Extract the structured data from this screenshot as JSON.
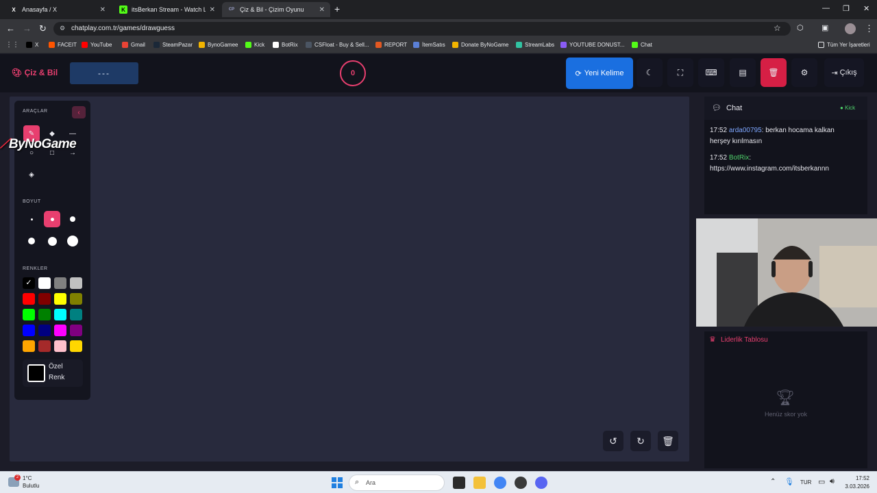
{
  "browser": {
    "tabs": [
      {
        "title": "Anasayfa / X",
        "favicon": "X"
      },
      {
        "title": "itsBerkan Stream - Watch Live o",
        "favicon": "K"
      },
      {
        "title": "Çiz & Bil - Çizim Oyunu",
        "favicon": "CP"
      }
    ],
    "url": "chatplay.com.tr/games/drawguess",
    "bookmarks": [
      "X",
      "FACEIT",
      "YouTube",
      "Gmail",
      "SteamPazar",
      "BynoGamee",
      "Kick",
      "BotRix",
      "CSFloat - Buy & Sell...",
      "REPORT",
      "İtemSatıs",
      "Donate ByNoGame",
      "StreamLabs",
      "YOUTUBE DONUST...",
      "Chat"
    ],
    "all_bookmarks": "Tüm Yer İşaretleri"
  },
  "app": {
    "logo": "Çiz & Bil",
    "word": "---",
    "timer": "0",
    "new_word": "Yeni Kelime",
    "exit": "Çıkış"
  },
  "tools": {
    "title": "ARAÇLAR",
    "size_title": "BOYUT",
    "colors_title": "RENKLER",
    "custom_color": "Özel Renk",
    "colors": [
      "#000000",
      "#ffffff",
      "#808080",
      "#c0c0c0",
      "#ff0000",
      "#800000",
      "#ffff00",
      "#808000",
      "#00ff00",
      "#008000",
      "#00ffff",
      "#008080",
      "#0000ff",
      "#000080",
      "#ff00ff",
      "#800080",
      "#ffa500",
      "#a52a2a",
      "#ffc0cb",
      "#ffd700"
    ]
  },
  "watermark": "ByNoGame",
  "chat": {
    "title": "Chat",
    "platform": "Kick",
    "messages": [
      {
        "time": "17:52",
        "user": "arda00795",
        "text": ": berkan hocama kalkan herşey kırılmasın"
      },
      {
        "time": "17:52",
        "user": "BotRix",
        "text": ": https://www.instagram.com/itsberkannn"
      }
    ]
  },
  "leaderboard": {
    "title": "Liderlik Tablosu",
    "empty": "Henüz skor yok"
  },
  "taskbar": {
    "weather_temp": "1°C",
    "weather_desc": "Bulutlu",
    "search": "Ara",
    "lang": "TUR",
    "time": "17:52",
    "date": "3.03.2026",
    "badge": "2"
  }
}
